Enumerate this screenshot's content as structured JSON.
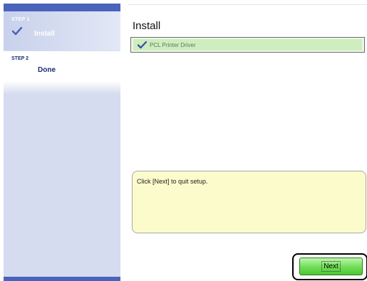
{
  "sidebar": {
    "steps": [
      {
        "label": "STEP 1",
        "name": "Install",
        "completed": true
      },
      {
        "label": "STEP 2",
        "name": "Done",
        "current": true
      }
    ]
  },
  "main": {
    "title": "Install",
    "items": [
      {
        "label": "PCL Printer Driver",
        "icon": "check-icon",
        "status": "installed"
      }
    ],
    "message": "Click [Next] to quit setup."
  },
  "buttons": {
    "next_label": "Next"
  },
  "colors": {
    "sidebar_bg": "#d6dcef",
    "sidebar_bar": "#4a64bb",
    "item_bg": "#cfedbf",
    "message_bg": "#fbfbcc",
    "button_green": "#74e05a"
  }
}
